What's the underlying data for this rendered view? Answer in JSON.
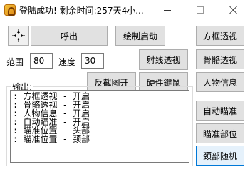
{
  "window": {
    "title": "登陆成功! 剩余时间:257天4小..."
  },
  "toolbar": {
    "call_out": "呼出",
    "draw_start": "绘制启动",
    "range_label": "范围",
    "range_value": "80",
    "speed_label": "速度",
    "speed_value": "30",
    "ray_esp": "射线透视",
    "anti_screenshot": "反截图开",
    "hardware_mouse": "硬件鍵鼠"
  },
  "side": {
    "box_esp": "方框透视",
    "bone_esp": "骨骼透视",
    "player_info": "人物信息",
    "auto_aim": "自动瞄准",
    "aim_part": "瞄准部位",
    "neck_random": "颈部随机"
  },
  "output": {
    "label": "输出:",
    "lines": [
      ": 方框透视 - 开启",
      ": 骨骼透视 - 开启",
      ": 人物信息 - 开启",
      ": 自动瞄准 - 开启",
      ": 瞄准位置 - 头部",
      ": 瞄准位置 - 颈部"
    ]
  },
  "icons": {
    "app": "lock-icon",
    "target": "crosshair-icon"
  }
}
